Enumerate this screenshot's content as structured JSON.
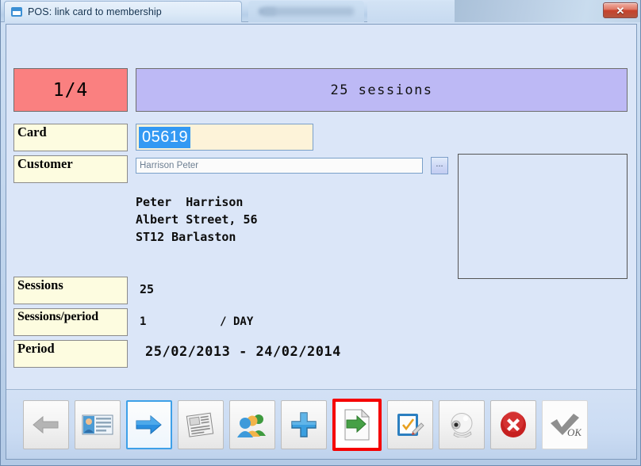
{
  "window": {
    "title": "POS: link card to membership",
    "icon": "window-icon",
    "close_label": "✕"
  },
  "form": {
    "badge": "1/4",
    "banner": "25 sessions",
    "labels": {
      "card": "Card",
      "customer": "Customer",
      "sessions": "Sessions",
      "sessions_period": "Sessions/period",
      "period": "Period"
    },
    "card_value": "05619",
    "customer_value": "Harrison Peter",
    "browse_label": "...",
    "address": "Peter  Harrison\nAlbert Street, 56\nST12 Barlaston",
    "sessions_value": "25",
    "sessions_period_value": "1           / DAY",
    "period_value": "25/02/2013 - 24/02/2014"
  },
  "toolbar": {
    "buttons": [
      {
        "name": "back-button",
        "icon": "left-arrow-icon",
        "state": "disabled"
      },
      {
        "name": "customer-card-button",
        "icon": "id-card-icon",
        "state": "normal"
      },
      {
        "name": "forward-button",
        "icon": "right-arrow-icon",
        "state": "focused"
      },
      {
        "name": "reports-button",
        "icon": "newspaper-icon",
        "state": "disabled"
      },
      {
        "name": "members-button",
        "icon": "people-group-icon",
        "state": "normal"
      },
      {
        "name": "add-button",
        "icon": "plus-icon",
        "state": "normal"
      },
      {
        "name": "link-card-button",
        "icon": "document-arrow-icon",
        "state": "highlighted"
      },
      {
        "name": "edit-form-button",
        "icon": "form-pencil-icon",
        "state": "normal"
      },
      {
        "name": "webcam-button",
        "icon": "webcam-icon",
        "state": "normal"
      },
      {
        "name": "cancel-button",
        "icon": "red-x-circle-icon",
        "state": "normal"
      },
      {
        "name": "ok-button",
        "icon": "ok-checkmark-icon",
        "state": "disabled"
      }
    ]
  },
  "colors": {
    "badge_bg": "#fa8080",
    "banner_bg": "#bdb9f5",
    "label_bg": "#fdfce0",
    "window_bg": "#dbe6f8",
    "selection": "#3399f3",
    "highlight_border": "#f50000",
    "focus_border": "#3ea0e8"
  }
}
